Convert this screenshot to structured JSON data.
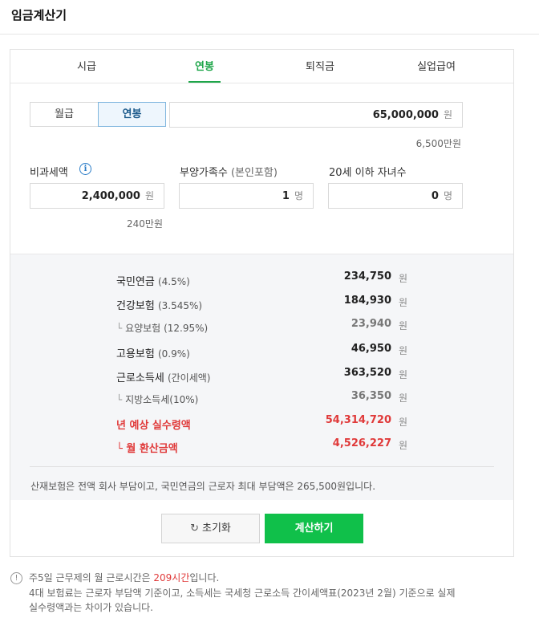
{
  "header": {
    "title": "임금계산기"
  },
  "tabs": [
    {
      "label": "시급",
      "active": false
    },
    {
      "label": "연봉",
      "active": true
    },
    {
      "label": "퇴직금",
      "active": false
    },
    {
      "label": "실업급여",
      "active": false
    }
  ],
  "mode": {
    "monthly_label": "월급",
    "annual_label": "연봉",
    "selected": "연봉"
  },
  "salary": {
    "value": "65,000,000",
    "unit": "원",
    "note": "6,500만원"
  },
  "nontax": {
    "label": "비과세액",
    "info_icon": "info-icon",
    "value": "2,400,000",
    "unit": "원",
    "note": "240만원"
  },
  "dependents": {
    "label": "부양가족수",
    "label_sub": "(본인포함)",
    "value": "1",
    "unit": "명"
  },
  "children": {
    "label": "20세 이하 자녀수",
    "value": "0",
    "unit": "명"
  },
  "results": [
    {
      "label": "국민연금",
      "pct": "(4.5%)",
      "value": "234,750",
      "unit": "원",
      "style": "main"
    },
    {
      "label": "건강보험",
      "pct": "(3.545%)",
      "value": "184,930",
      "unit": "원",
      "style": "main"
    },
    {
      "tree": "└",
      "label": "요양보험",
      "pct": "(12.95%)",
      "value": "23,940",
      "unit": "원",
      "style": "sub"
    },
    {
      "label": "고용보험",
      "pct": "(0.9%)",
      "value": "46,950",
      "unit": "원",
      "style": "main"
    },
    {
      "label": "근로소득세",
      "pct": "(간이세액)",
      "value": "363,520",
      "unit": "원",
      "style": "main"
    },
    {
      "tree": "└",
      "label": "지방소득세",
      "pct": "(10%)",
      "value": "36,350",
      "unit": "원",
      "style": "sub"
    },
    {
      "label": "년 예상 실수령액",
      "pct": "",
      "value": "54,314,720",
      "unit": "원",
      "style": "red"
    },
    {
      "tree": "└",
      "label": "월 환산금액",
      "pct": "",
      "value": "4,526,227",
      "unit": "원",
      "style": "red"
    }
  ],
  "result_note": "산재보험은 전액 회사 부담이고, 국민연금의 근로자 최대 부담액은 265,500원입니다.",
  "buttons": {
    "reset_icon": "↻",
    "reset_label": "초기화",
    "calc_label": "계산하기"
  },
  "footer": {
    "icon": "!",
    "line1_pre": "주5일 근무제의 월 근로시간은 ",
    "line1_hl": "209시간",
    "line1_post": "입니다.",
    "line2": "4대 보험료는 근로자 부담액 기준이고, 소득세는 국세청 근로소득 간이세액표(2023년 2월) 기준으로 실제",
    "line3": "실수령액과는 차이가 있습니다."
  },
  "colors": {
    "accent_green": "#1ea64a",
    "button_green": "#10c04a",
    "highlight_red": "#e03a3a",
    "info_blue": "#2a7cc7"
  }
}
